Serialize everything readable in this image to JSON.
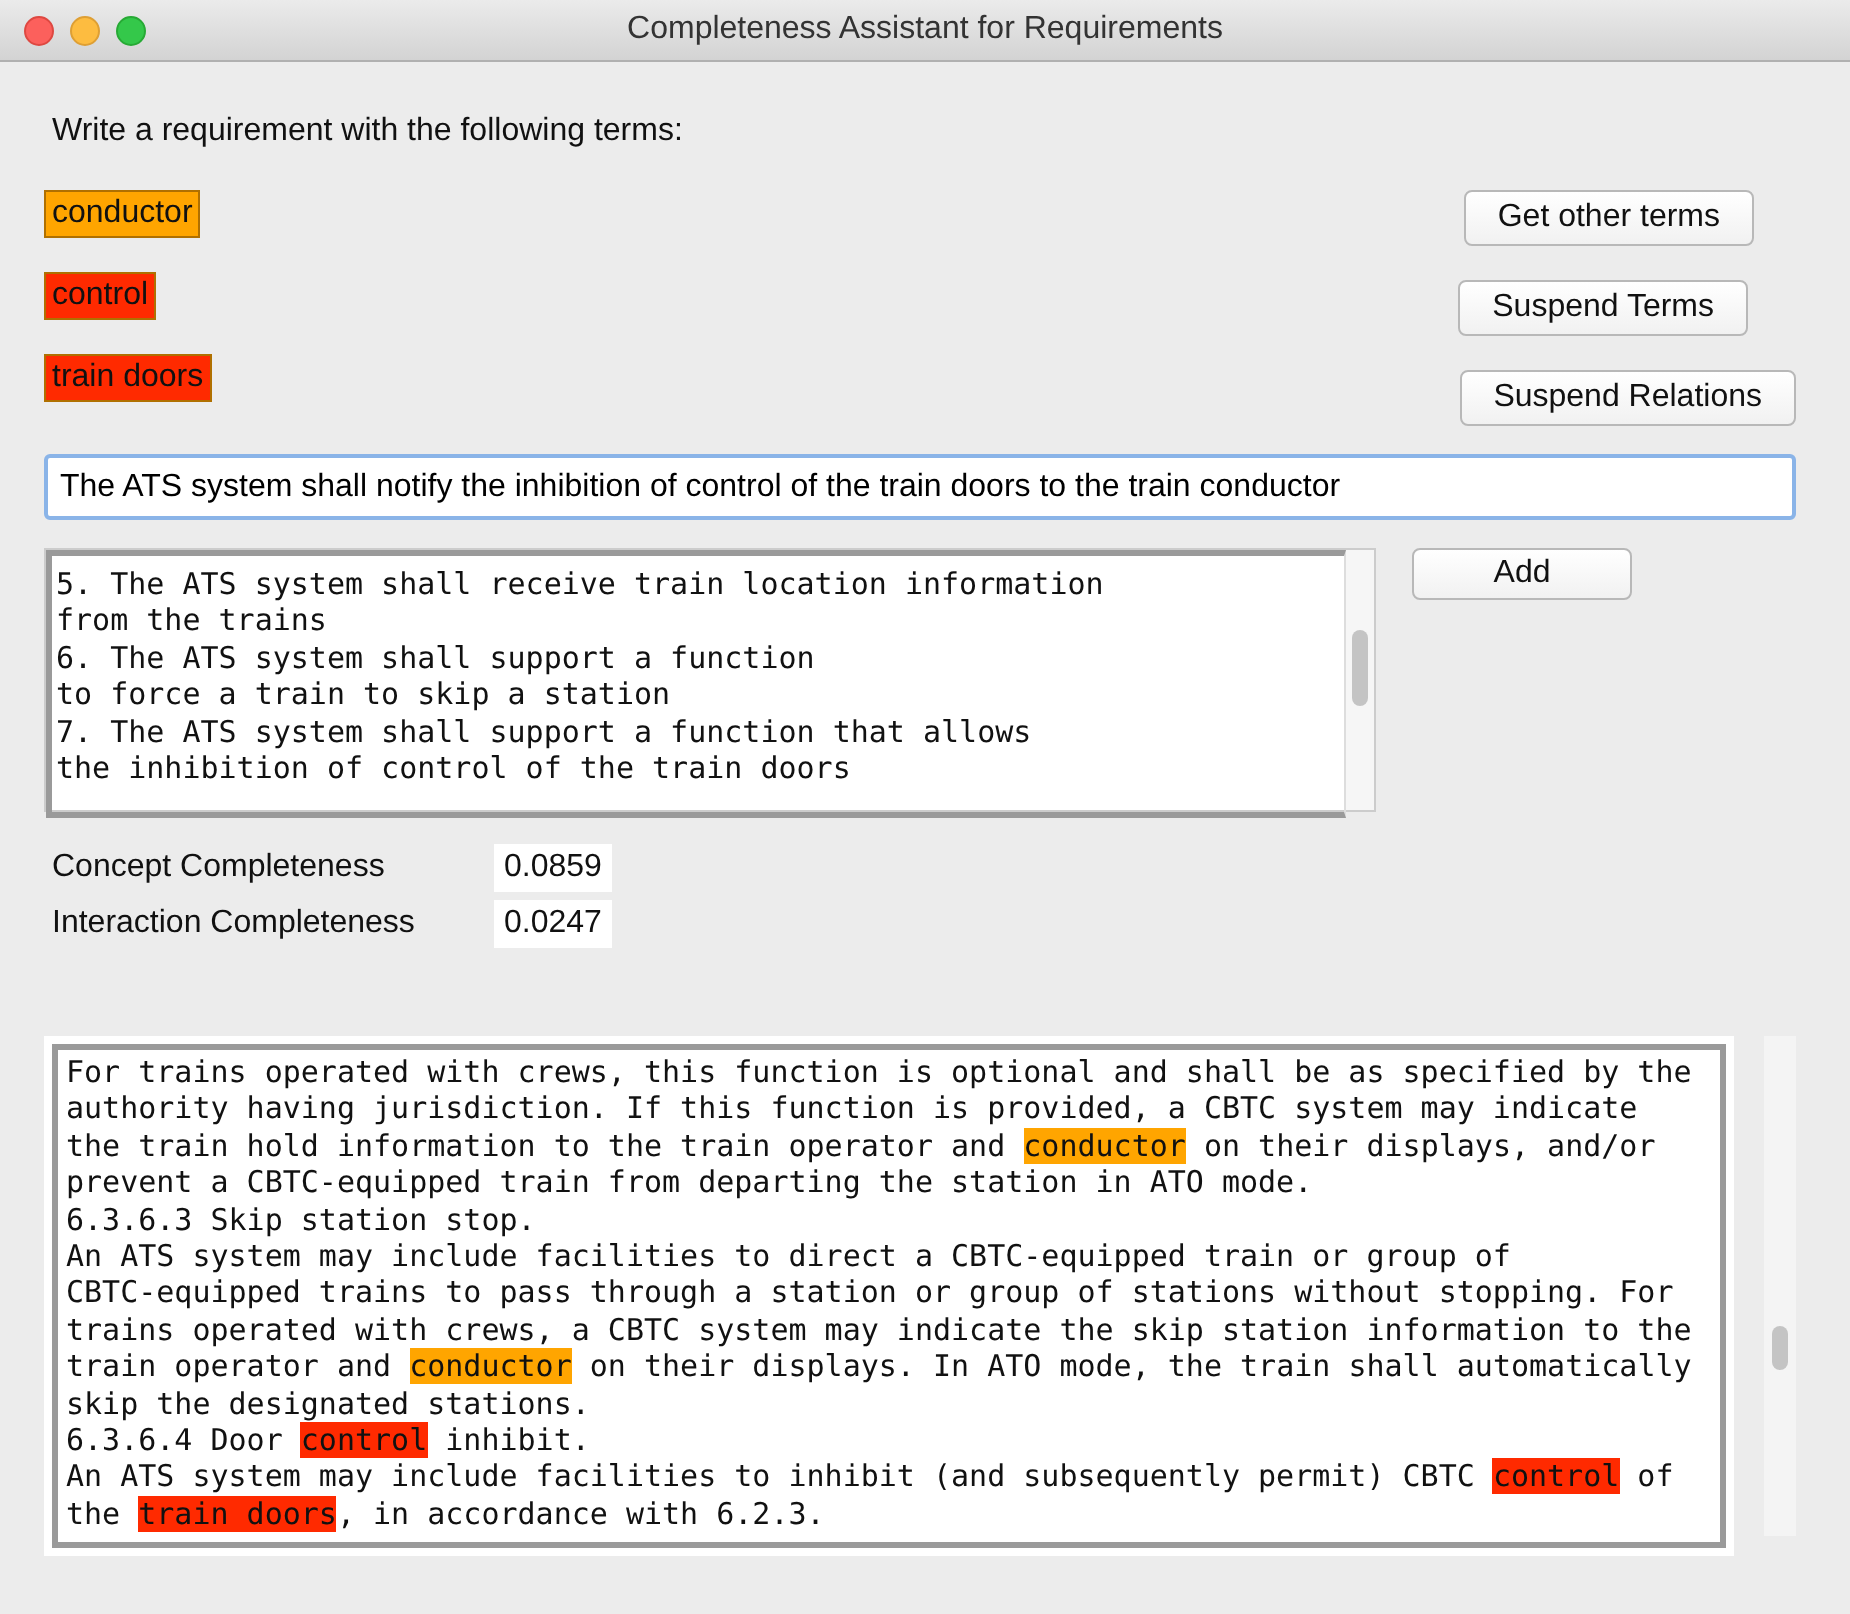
{
  "window": {
    "title": "Completeness Assistant for Requirements"
  },
  "instruction": "Write a requirement with the following terms:",
  "terms": [
    {
      "label": "conductor",
      "color": "#ffa500"
    },
    {
      "label": "control",
      "color": "#ff2a00"
    },
    {
      "label": "train doors",
      "color": "#ff2a00"
    }
  ],
  "buttons": [
    "Get other terms",
    "Suspend Terms",
    "Suspend Relations"
  ],
  "requirement_input": {
    "value": "The ATS system shall notify the inhibition of control of the train doors to the train conductor"
  },
  "requirements_list": [
    "5. The ATS system shall receive train location information",
    "from the trains",
    "6. The ATS system shall support a function",
    "to force a train to skip a station",
    "7. The ATS system shall support a function that allows",
    "the inhibition of control of the train doors"
  ],
  "add_button": "Add",
  "metrics": [
    {
      "label": "Concept Completeness",
      "value": "0.0859"
    },
    {
      "label": "Interaction Completeness",
      "value": "0.0247"
    }
  ],
  "document_lines": [
    {
      "segments": [
        {
          "text": "For trains operated with crews, this function is optional and shall be as specified by the"
        }
      ]
    },
    {
      "segments": [
        {
          "text": "authority having jurisdiction. If this function is provided, a CBTC system may indicate"
        }
      ]
    },
    {
      "segments": [
        {
          "text": "the train hold information to the train operator and "
        },
        {
          "text": "conductor",
          "color": "#ffa500"
        },
        {
          "text": " on their displays, and/or"
        }
      ]
    },
    {
      "segments": [
        {
          "text": "prevent a CBTC-equipped train from departing the station in ATO mode."
        }
      ]
    },
    {
      "segments": [
        {
          "text": "6.3.6.3 Skip station stop."
        }
      ]
    },
    {
      "segments": [
        {
          "text": "An ATS system may include facilities to direct a CBTC-equipped train or group of"
        }
      ]
    },
    {
      "segments": [
        {
          "text": "CBTC-equipped trains to pass through a station or group of stations without stopping. For"
        }
      ]
    },
    {
      "segments": [
        {
          "text": "trains operated with crews, a CBTC system may indicate the skip station information to the"
        }
      ]
    },
    {
      "segments": [
        {
          "text": "train operator and "
        },
        {
          "text": "conductor",
          "color": "#ffa500"
        },
        {
          "text": " on their displays. In ATO mode, the train shall automatically"
        }
      ]
    },
    {
      "segments": [
        {
          "text": "skip the designated stations."
        }
      ]
    },
    {
      "segments": [
        {
          "text": "6.3.6.4 Door "
        },
        {
          "text": "control",
          "color": "#ff2a00"
        },
        {
          "text": " inhibit."
        }
      ]
    },
    {
      "segments": [
        {
          "text": "An ATS system may include facilities to inhibit (and subsequently permit) CBTC "
        },
        {
          "text": "control",
          "color": "#ff2a00"
        },
        {
          "text": " of"
        }
      ]
    },
    {
      "segments": [
        {
          "text": "the "
        },
        {
          "text": "train doors",
          "color": "#ff2a00"
        },
        {
          "text": ", in accordance with 6.2.3."
        }
      ]
    }
  ]
}
